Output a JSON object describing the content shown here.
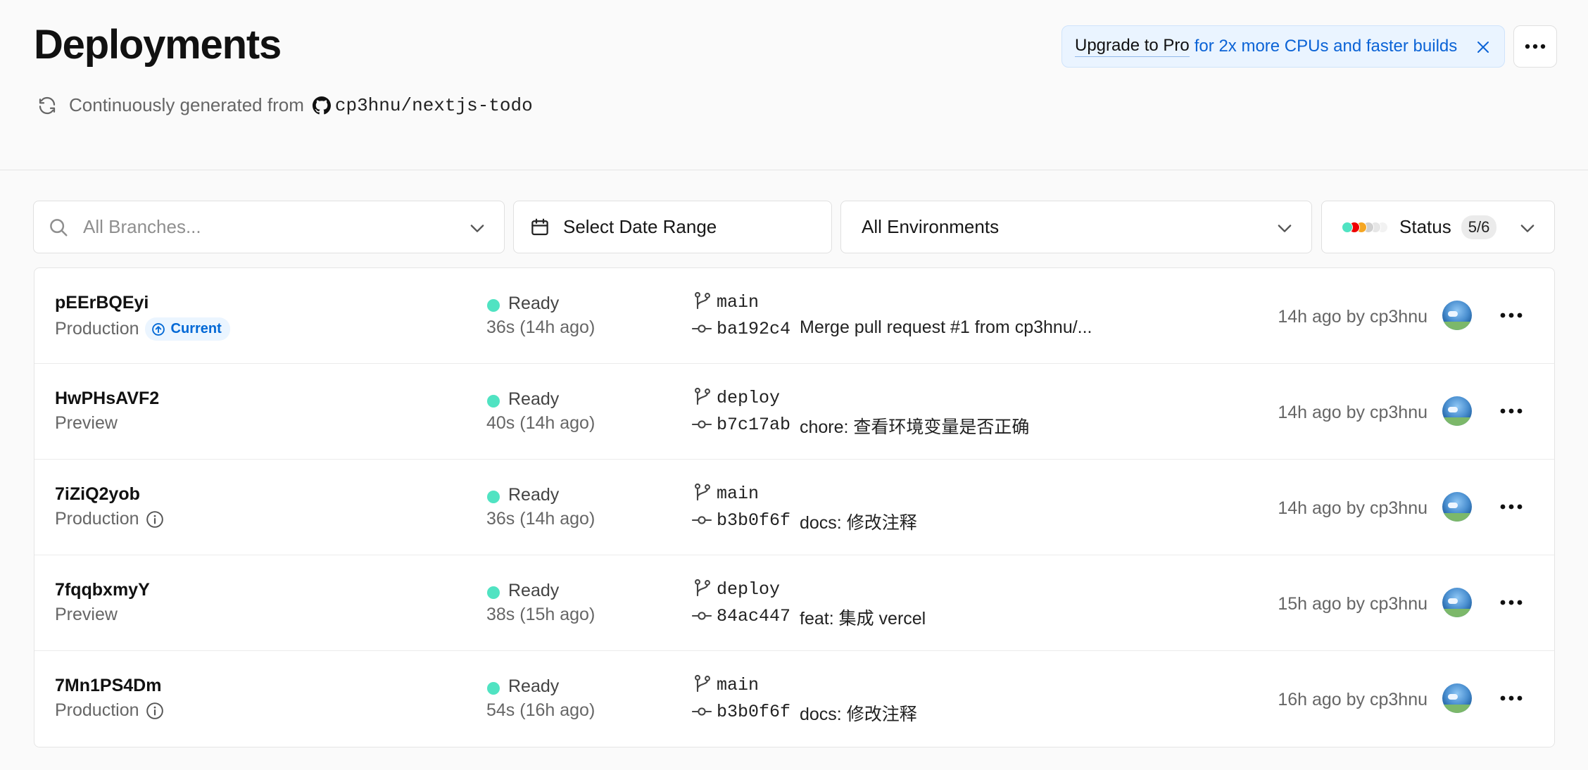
{
  "header": {
    "title": "Deployments",
    "subtitle_prefix": "Continuously generated from",
    "repo": "cp3hnu/nextjs-todo"
  },
  "upgrade_banner": {
    "strong_text": "Upgrade to Pro",
    "rest_text": "for 2x more CPUs and faster builds"
  },
  "filters": {
    "branches_placeholder": "All Branches...",
    "date_label": "Select Date Range",
    "environment_label": "All Environments",
    "status_label": "Status",
    "status_count": "5/6",
    "status_dot_colors": [
      "#50e3c2",
      "#ee0000",
      "#f5a623",
      "#d0d0d0",
      "#e6e6e6",
      "#f2f2f2"
    ]
  },
  "colors": {
    "ready": "#50e3c2",
    "accent": "#0068d6"
  },
  "deployments": [
    {
      "id": "pEErBQEyi",
      "environment": "Production",
      "badge": "Current",
      "status": "Ready",
      "duration": "36s (14h ago)",
      "branch": "main",
      "sha": "ba192c4",
      "message": "Merge pull request #1 from cp3hnu/...",
      "age": "14h ago by cp3hnu"
    },
    {
      "id": "HwPHsAVF2",
      "environment": "Preview",
      "status": "Ready",
      "duration": "40s (14h ago)",
      "branch": "deploy",
      "sha": "b7c17ab",
      "message": "chore: 查看环境变量是否正确",
      "age": "14h ago by cp3hnu"
    },
    {
      "id": "7iZiQ2yob",
      "environment": "Production",
      "status": "Ready",
      "duration": "36s (14h ago)",
      "branch": "main",
      "sha": "b3b0f6f",
      "message": "docs: 修改注释",
      "age": "14h ago by cp3hnu"
    },
    {
      "id": "7fqqbxmyY",
      "environment": "Preview",
      "status": "Ready",
      "duration": "38s (15h ago)",
      "branch": "deploy",
      "sha": "84ac447",
      "message": "feat: 集成 vercel",
      "age": "15h ago by cp3hnu"
    },
    {
      "id": "7Mn1PS4Dm",
      "environment": "Production",
      "status": "Ready",
      "duration": "54s (16h ago)",
      "branch": "main",
      "sha": "b3b0f6f",
      "message": "docs: 修改注释",
      "age": "16h ago by cp3hnu"
    }
  ]
}
